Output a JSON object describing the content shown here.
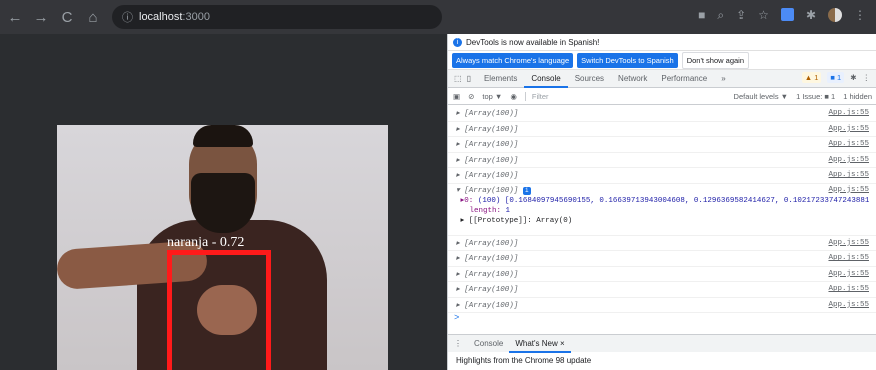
{
  "browser": {
    "url_host": "localhost",
    "url_port": ":3000"
  },
  "video": {
    "detection_label": "naranja - 0.72"
  },
  "devtools": {
    "notice": "DevTools is now available in Spanish!",
    "btn_match": "Always match Chrome's language",
    "btn_switch": "Switch DevTools to Spanish",
    "btn_dont": "Don't show again",
    "tabs": [
      "Elements",
      "Console",
      "Sources",
      "Network",
      "Performance"
    ],
    "more_tabs": "»",
    "warn_count": "1",
    "info_count": "1",
    "context": "top ▼",
    "filter_placeholder": "Filter",
    "default_levels": "Default levels ▼",
    "issues": "1 Issue: ■ 1",
    "hidden": "1 hidden",
    "rows_before": [
      "▸ [Array(100)]",
      "▸ [Array(100)]",
      "▸ [Array(100)]",
      "▸ [Array(100)]",
      "▸ [Array(100)]"
    ],
    "source": "App.js:55",
    "expanded_head": "▾ [Array(100)]",
    "expanded_badge": "i",
    "expanded_line1_key": "▸0:",
    "expanded_line1_val": "(100) [0.1684097945690155, 0.16639713943004608, 0.1296369582414627, 0.10217233747243881,",
    "expanded_len_key": "length:",
    "expanded_len_val": "1",
    "expanded_proto": "▸ [[Prototype]]: Array(0)",
    "rows_after": [
      "▸ [Array(100)]",
      "▸ [Array(100)]",
      "▸ [Array(100)]",
      "▸ [Array(100)]",
      "▸ [Array(100)]"
    ],
    "prompt": ">",
    "drawer_tabs": [
      "Console",
      "What's New ×"
    ],
    "highlights": "Highlights from the Chrome 98 update"
  }
}
